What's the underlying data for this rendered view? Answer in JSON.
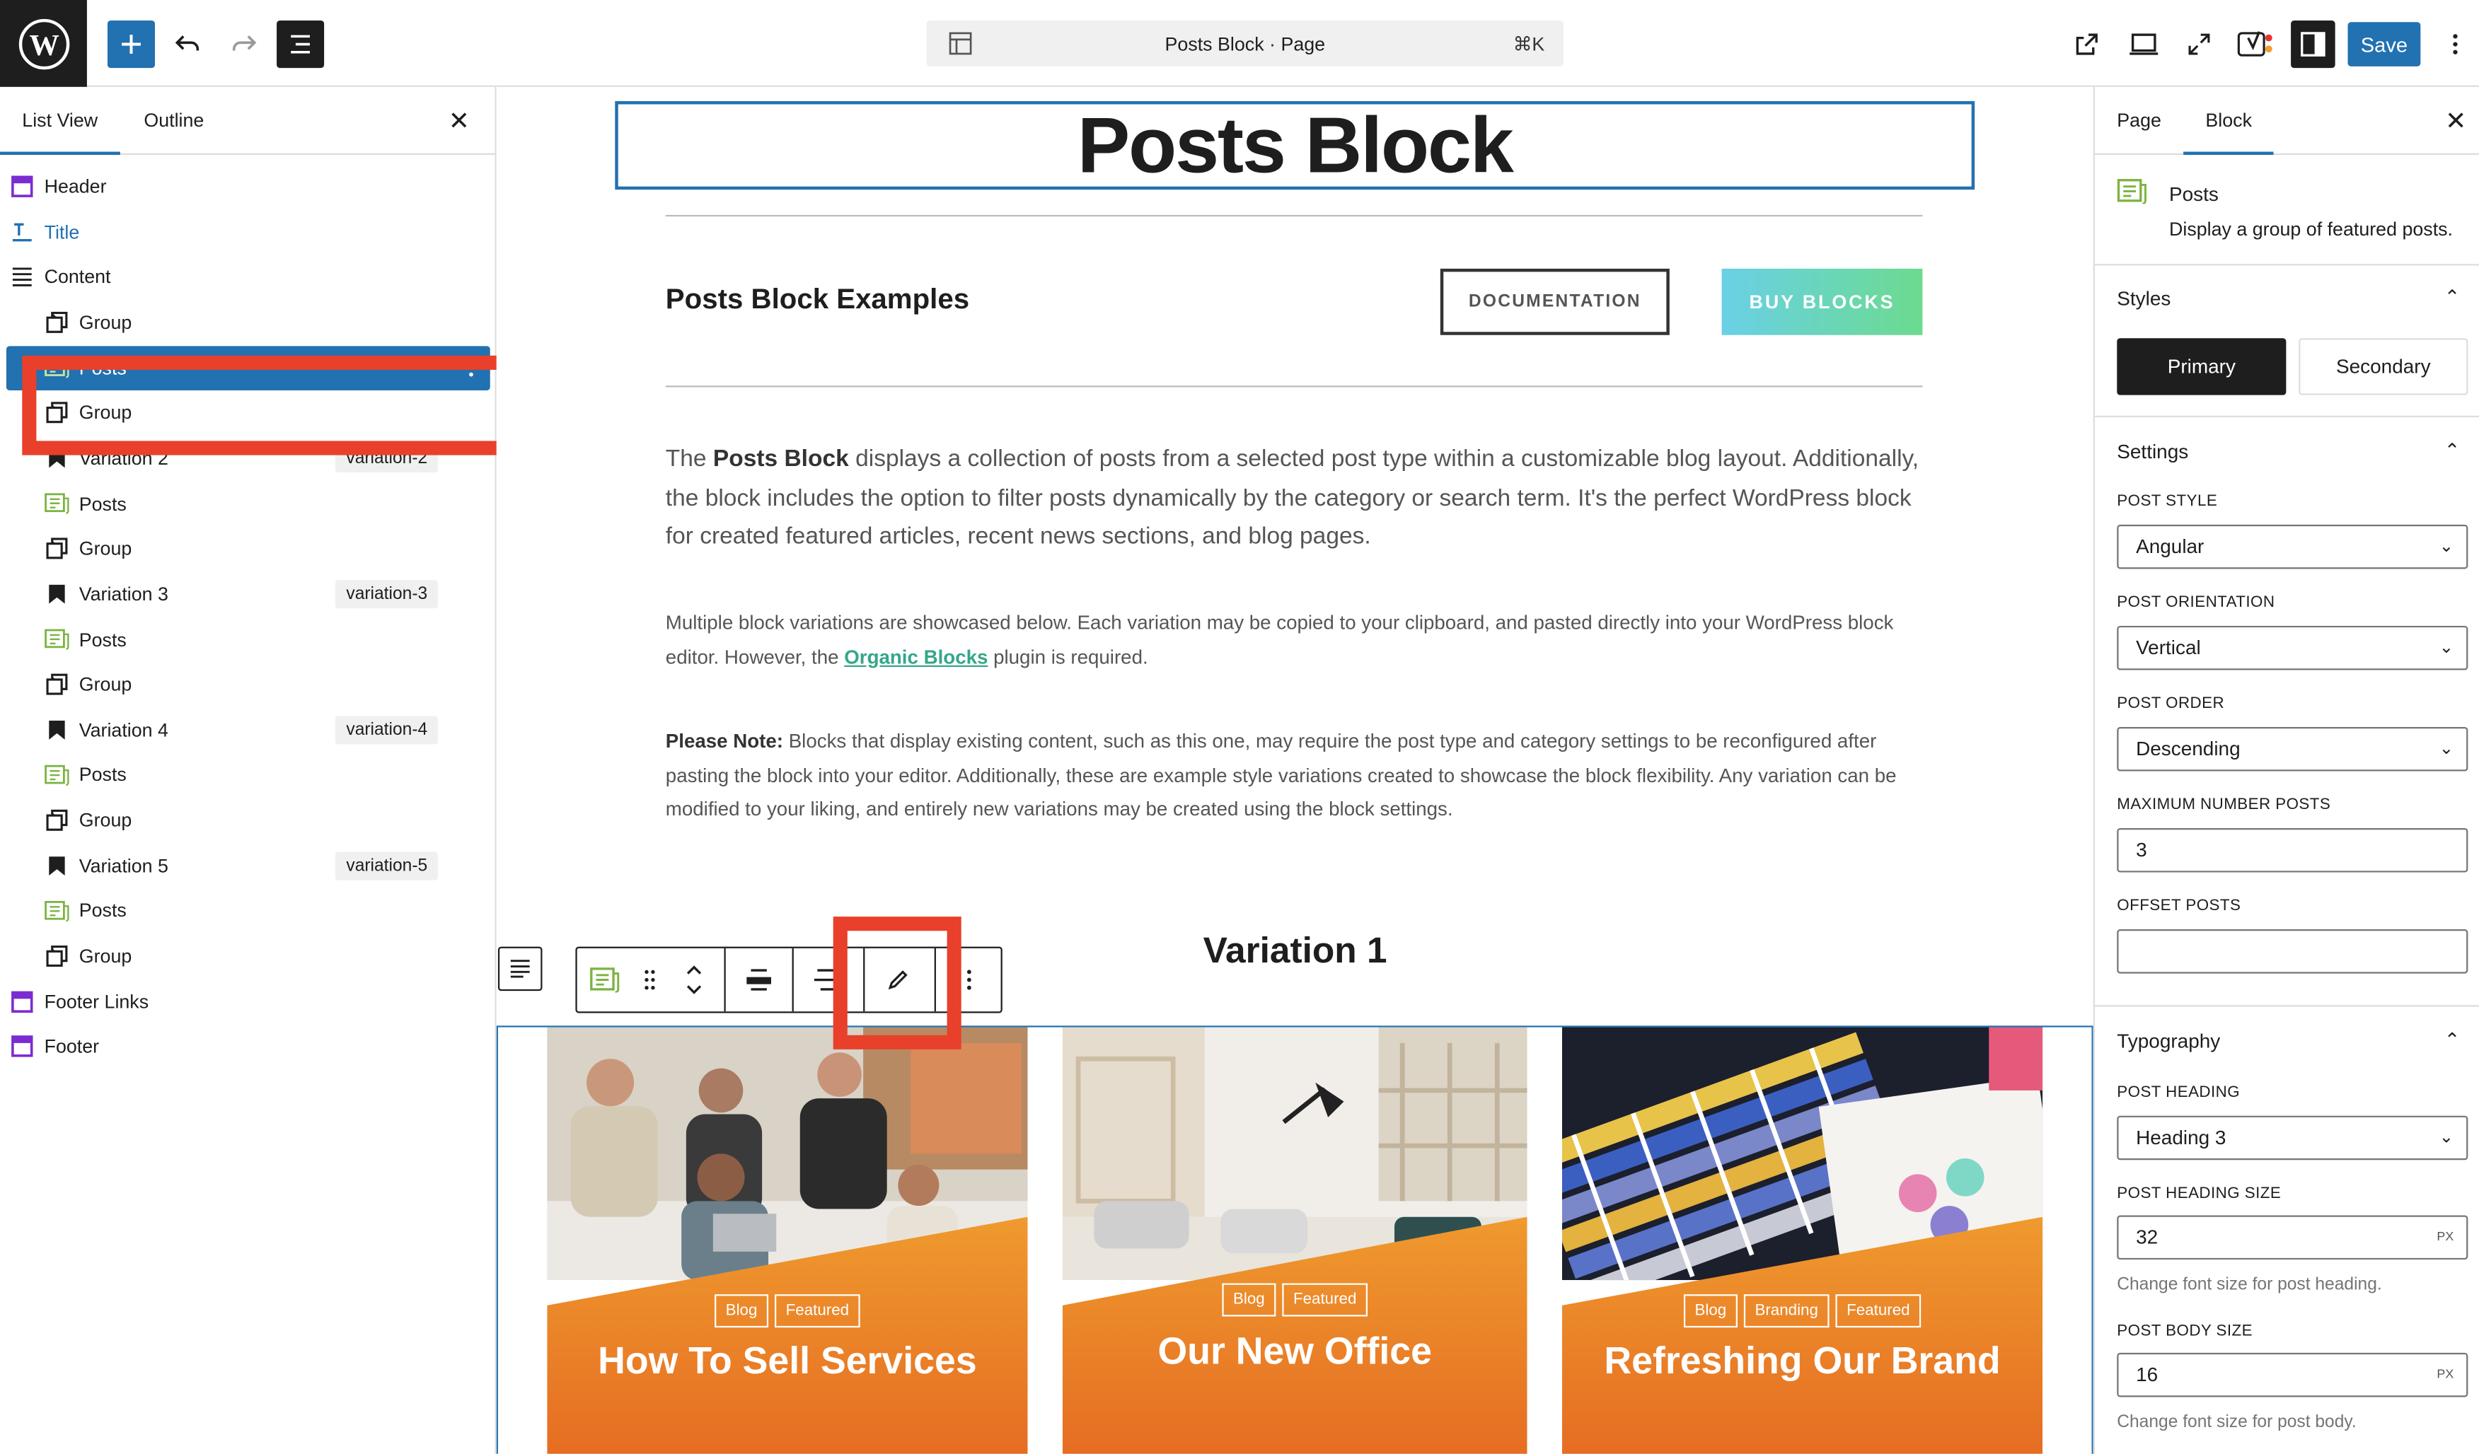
{
  "topbar": {
    "doc_title": "Posts Block · Page",
    "shortcut": "⌘K",
    "save_label": "Save"
  },
  "left_panel": {
    "tabs": [
      "List View",
      "Outline"
    ],
    "items": [
      {
        "label": "Header",
        "icon": "template-part-icon"
      },
      {
        "label": "Title",
        "icon": "title-icon"
      },
      {
        "label": "Content",
        "icon": "content-icon"
      },
      {
        "label": "Group",
        "icon": "group-icon"
      },
      {
        "label": "Posts",
        "icon": "posts-icon"
      },
      {
        "label": "Group",
        "icon": "group-icon"
      },
      {
        "label": "Variation 2",
        "icon": "bookmark-icon",
        "badge": "variation-2"
      },
      {
        "label": "Posts",
        "icon": "posts-icon"
      },
      {
        "label": "Group",
        "icon": "group-icon"
      },
      {
        "label": "Variation 3",
        "icon": "bookmark-icon",
        "badge": "variation-3"
      },
      {
        "label": "Posts",
        "icon": "posts-icon"
      },
      {
        "label": "Group",
        "icon": "group-icon"
      },
      {
        "label": "Variation 4",
        "icon": "bookmark-icon",
        "badge": "variation-4"
      },
      {
        "label": "Posts",
        "icon": "posts-icon"
      },
      {
        "label": "Group",
        "icon": "group-icon"
      },
      {
        "label": "Variation 5",
        "icon": "bookmark-icon",
        "badge": "variation-5"
      },
      {
        "label": "Posts",
        "icon": "posts-icon"
      },
      {
        "label": "Group",
        "icon": "group-icon"
      },
      {
        "label": "Footer Links",
        "icon": "template-part-icon"
      },
      {
        "label": "Footer",
        "icon": "template-part-icon"
      }
    ]
  },
  "canvas": {
    "page_title": "Posts Block",
    "examples_heading": "Posts Block Examples",
    "documentation_label": "DOCUMENTATION",
    "buy_label": "BUY BLOCKS",
    "para1_pre": "The ",
    "para1_bold": "Posts Block",
    "para1_post": " displays a collection of posts from a selected post type within a customizable blog layout. Additionally, the block includes the option to filter posts dynamically by the category or search term. It's the perfect WordPress block for created featured articles, recent news sections, and blog pages.",
    "para2_pre": "Multiple block variations are showcased below. Each variation may be copied to your clipboard, and pasted directly into your WordPress block editor. However, the ",
    "para2_link": "Organic Blocks",
    "para2_post": " plugin is required.",
    "para3_bold": "Please Note:",
    "para3_post": " Blocks that display existing content, such as this one, may require the post type and category settings to be reconfigured after pasting the block into your editor. Additionally, these are example style variations created to showcase the block flexibility. Any variation can be modified to your liking, and entirely new variations may be created using the block settings.",
    "variation_heading": "Variation 1",
    "cards": [
      {
        "tags": [
          "Blog",
          "Featured"
        ],
        "title": "How To Sell Services"
      },
      {
        "tags": [
          "Blog",
          "Featured"
        ],
        "title": "Our New Office"
      },
      {
        "tags": [
          "Blog",
          "Branding",
          "Featured"
        ],
        "title": "Refreshing Our Brand"
      }
    ]
  },
  "right_panel": {
    "tabs": [
      "Page",
      "Block"
    ],
    "block_name": "Posts",
    "block_desc": "Display a group of featured posts.",
    "styles_heading": "Styles",
    "style_primary": "Primary",
    "style_secondary": "Secondary",
    "settings_heading": "Settings",
    "post_style_label": "POST STYLE",
    "post_style_value": "Angular",
    "post_orientation_label": "POST ORIENTATION",
    "post_orientation_value": "Vertical",
    "post_order_label": "POST ORDER",
    "post_order_value": "Descending",
    "max_posts_label": "MAXIMUM NUMBER POSTS",
    "max_posts_value": "3",
    "offset_label": "OFFSET POSTS",
    "offset_value": "",
    "typography_heading": "Typography",
    "post_heading_label": "POST HEADING",
    "post_heading_value": "Heading 3",
    "heading_size_label": "POST HEADING SIZE",
    "heading_size_value": "32",
    "heading_size_help": "Change font size for post heading.",
    "body_size_label": "POST BODY SIZE",
    "body_size_value": "16",
    "body_size_help": "Change font size for post body.",
    "unit": "PX"
  },
  "colors": {
    "accent": "#2271b1",
    "highlight_box": "#e8402a",
    "buy_gradient_start": "#6ad0e6",
    "buy_gradient_end": "#6bdb8f",
    "card_orange": "#ea7d28"
  }
}
